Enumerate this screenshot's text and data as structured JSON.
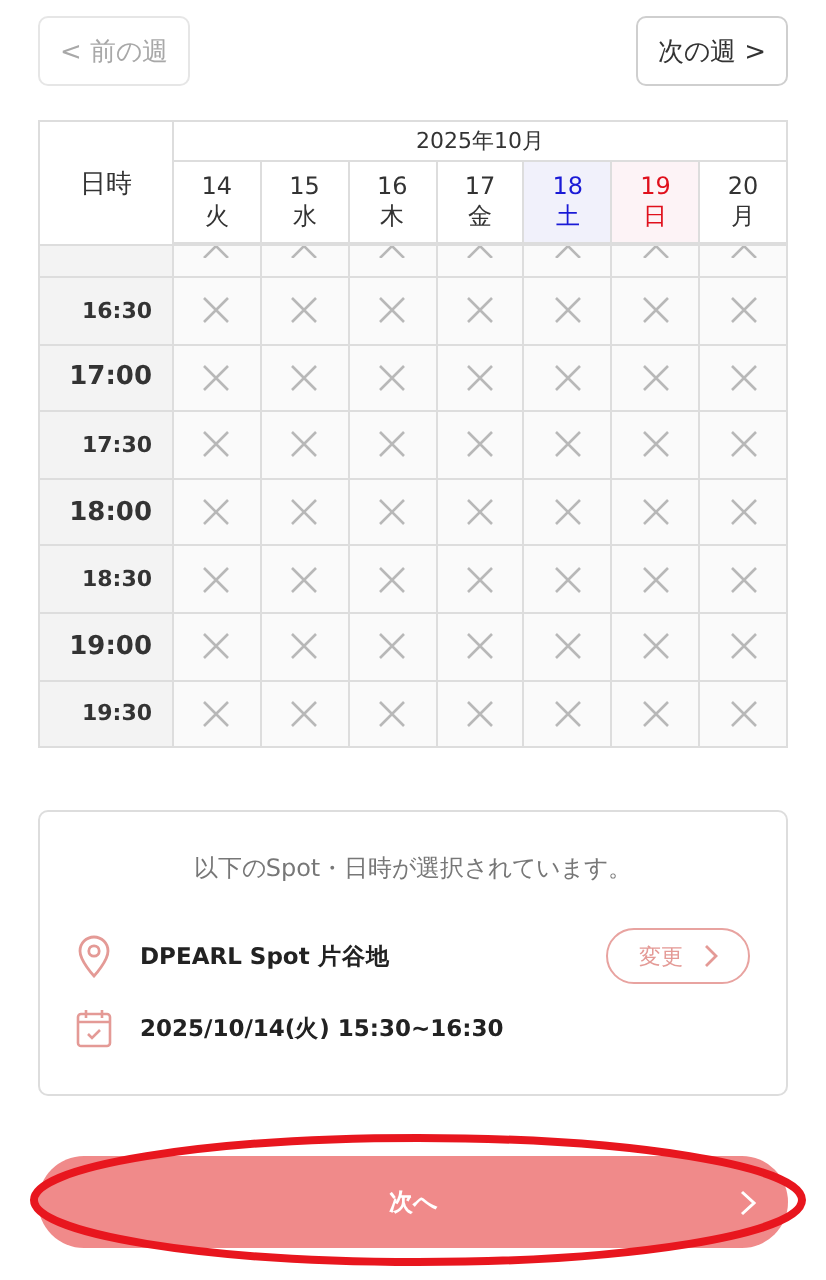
{
  "week_nav": {
    "prev": {
      "label": "< 前の週",
      "disabled": true
    },
    "next": {
      "label": "次の週 >",
      "disabled": false
    }
  },
  "table": {
    "corner": "日時",
    "month": "2025年10月",
    "days": [
      {
        "date": "14",
        "weekday": "火",
        "kind": "weekday"
      },
      {
        "date": "15",
        "weekday": "水",
        "kind": "weekday"
      },
      {
        "date": "16",
        "weekday": "木",
        "kind": "weekday"
      },
      {
        "date": "17",
        "weekday": "金",
        "kind": "weekday"
      },
      {
        "date": "18",
        "weekday": "土",
        "kind": "saturday"
      },
      {
        "date": "19",
        "weekday": "日",
        "kind": "sunday"
      },
      {
        "date": "20",
        "weekday": "月",
        "kind": "weekday"
      }
    ],
    "rows": [
      {
        "kind": "partial",
        "slots": [
          false,
          false,
          false,
          false,
          false,
          false,
          false
        ]
      },
      {
        "kind": "half",
        "time": "16:30",
        "slots": [
          false,
          false,
          false,
          false,
          false,
          false,
          false
        ]
      },
      {
        "kind": "hour",
        "time": "17:00",
        "slots": [
          false,
          false,
          false,
          false,
          false,
          false,
          false
        ]
      },
      {
        "kind": "half",
        "time": "17:30",
        "slots": [
          false,
          false,
          false,
          false,
          false,
          false,
          false
        ]
      },
      {
        "kind": "hour",
        "time": "18:00",
        "slots": [
          false,
          false,
          false,
          false,
          false,
          false,
          false
        ]
      },
      {
        "kind": "half",
        "time": "18:30",
        "slots": [
          false,
          false,
          false,
          false,
          false,
          false,
          false
        ]
      },
      {
        "kind": "hour",
        "time": "19:00",
        "slots": [
          false,
          false,
          false,
          false,
          false,
          false,
          false
        ]
      },
      {
        "kind": "half",
        "time": "19:30",
        "slots": [
          false,
          false,
          false,
          false,
          false,
          false,
          false
        ]
      }
    ]
  },
  "summary": {
    "title": "以下のSpot・日時が選択されています。",
    "spot": "DPEARL Spot 片谷地",
    "change_button": "変更",
    "datetime": "2025/10/14(火) 15:30~16:30"
  },
  "next_button": {
    "label": "次へ",
    "circled": true
  }
}
